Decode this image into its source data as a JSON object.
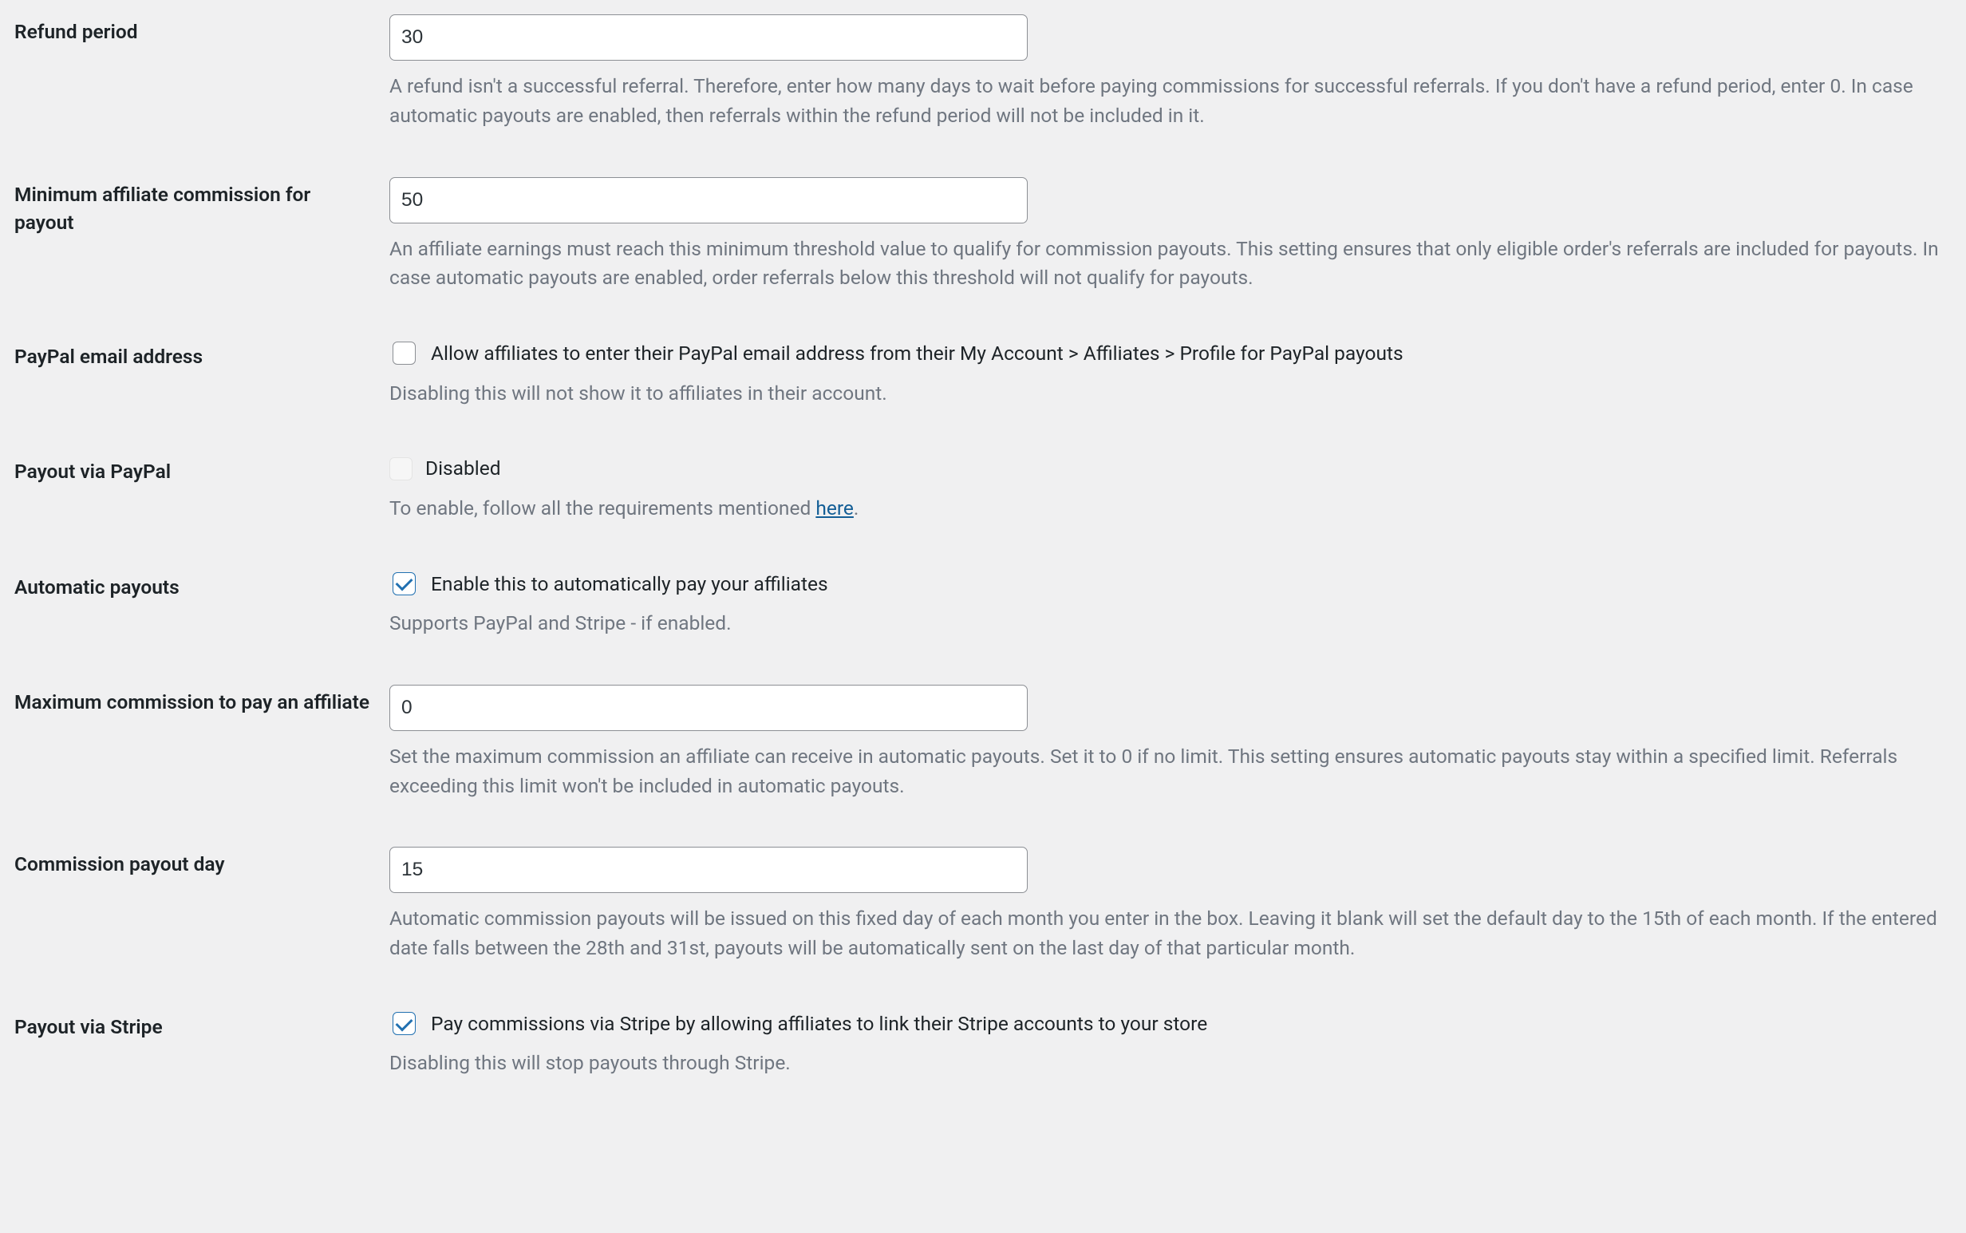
{
  "refund_period": {
    "label": "Refund period",
    "value": "30",
    "desc": "A refund isn't a successful referral. Therefore, enter how many days to wait before paying commissions for successful referrals. If you don't have a refund period, enter 0. In case automatic payouts are enabled, then referrals within the refund period will not be included in it."
  },
  "min_commission": {
    "label": "Minimum affiliate commission for payout",
    "value": "50",
    "desc": "An affiliate earnings must reach this minimum threshold value to qualify for commission payouts. This setting ensures that only eligible order's referrals are included for payouts. In case automatic payouts are enabled, order referrals below this threshold will not qualify for payouts."
  },
  "paypal_email": {
    "label": "PayPal email address",
    "checkbox_label": "Allow affiliates to enter their PayPal email address from their My Account > Affiliates > Profile for PayPal payouts",
    "desc": "Disabling this will not show it to affiliates in their account."
  },
  "payout_paypal": {
    "label": "Payout via PayPal",
    "status": "Disabled",
    "desc_prefix": "To enable, follow all the requirements mentioned ",
    "link_text": "here",
    "desc_suffix": "."
  },
  "auto_payouts": {
    "label": "Automatic payouts",
    "checkbox_label": "Enable this to automatically pay your affiliates",
    "desc": "Supports PayPal and Stripe - if enabled."
  },
  "max_commission": {
    "label": "Maximum commission to pay an affiliate",
    "value": "0",
    "desc": "Set the maximum commission an affiliate can receive in automatic payouts. Set it to 0 if no limit. This setting ensures automatic payouts stay within a specified limit. Referrals exceeding this limit won't be included in automatic payouts."
  },
  "payout_day": {
    "label": "Commission payout day",
    "value": "15",
    "desc": "Automatic commission payouts will be issued on this fixed day of each month you enter in the box. Leaving it blank will set the default day to the 15th of each month. If the entered date falls between the 28th and 31st, payouts will be automatically sent on the last day of that particular month."
  },
  "payout_stripe": {
    "label": "Payout via Stripe",
    "checkbox_label": "Pay commissions via Stripe by allowing affiliates to link their Stripe accounts to your store",
    "desc": "Disabling this will stop payouts through Stripe."
  }
}
